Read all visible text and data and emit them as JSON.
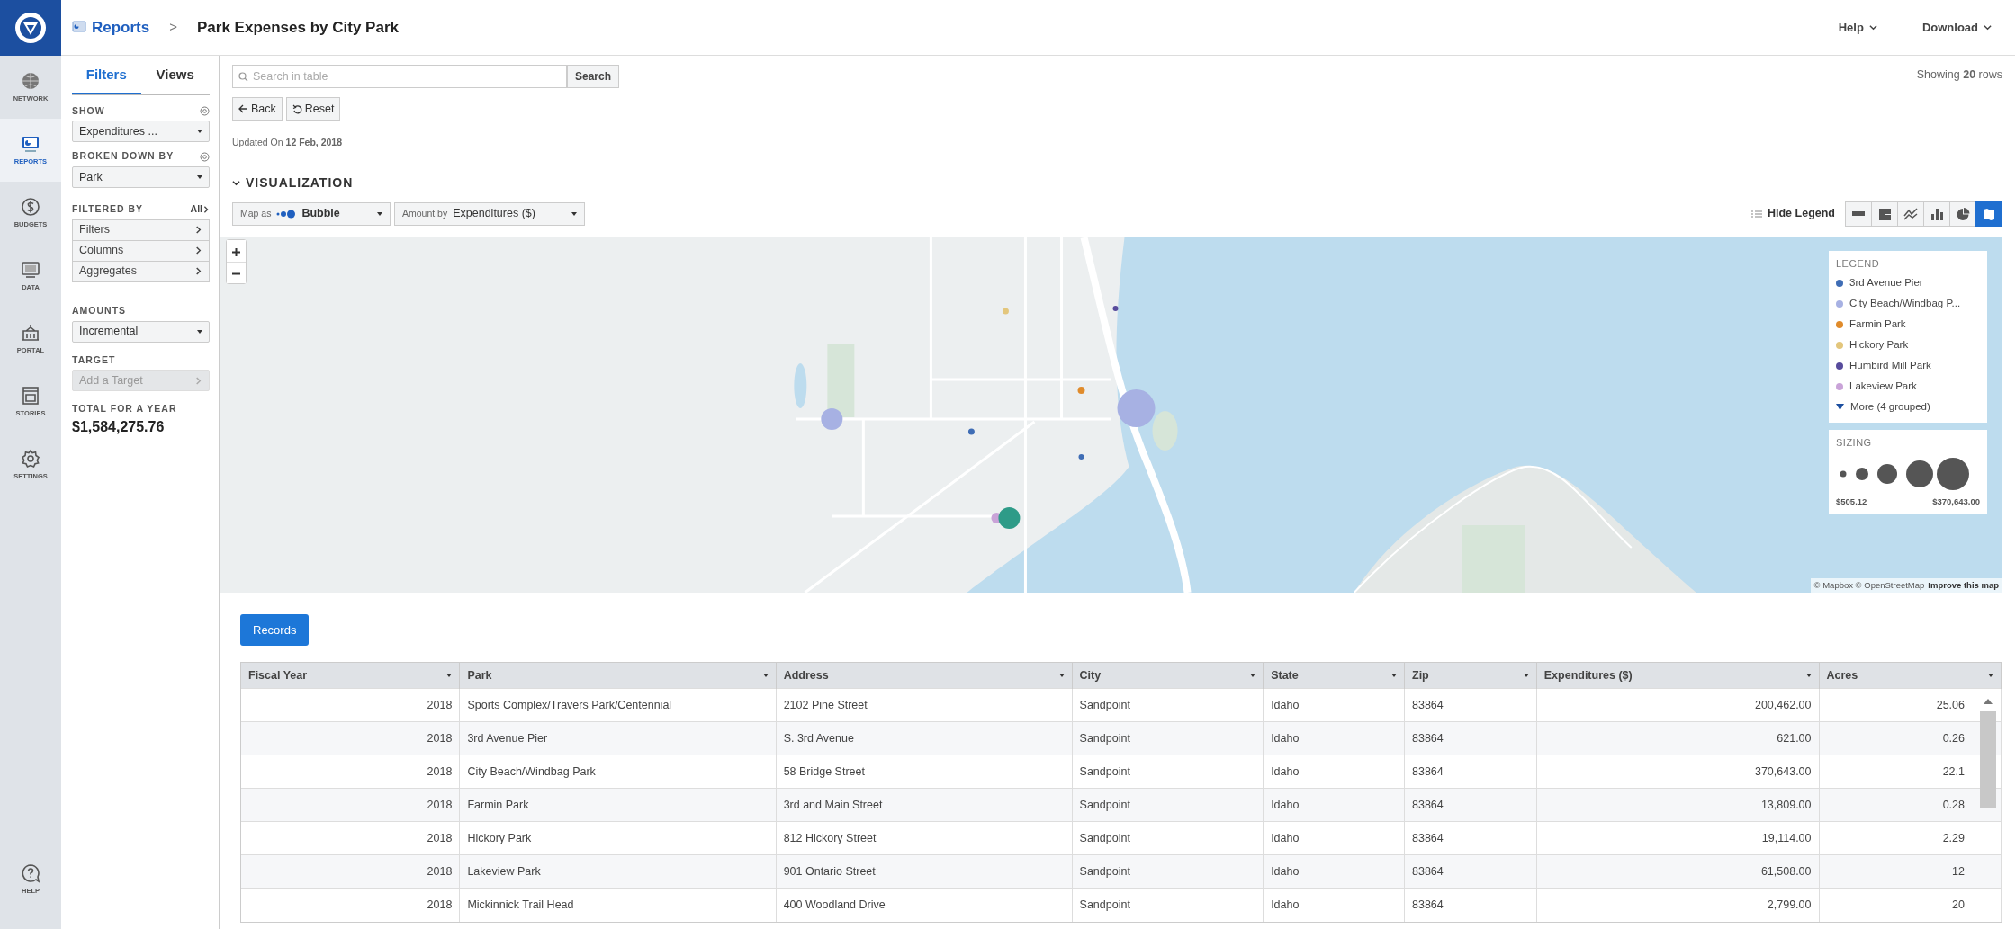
{
  "header": {
    "breadcrumb": "Reports",
    "separator": ">",
    "title": "Park Expenses by City Park",
    "menus": [
      {
        "label": "Help"
      },
      {
        "label": "Download"
      }
    ]
  },
  "nav": {
    "items": [
      {
        "label": "NETWORK",
        "kind": "globe",
        "selected": false
      },
      {
        "label": "REPORTS",
        "kind": "reports",
        "selected": true
      },
      {
        "label": "BUDGETS",
        "kind": "dollar",
        "selected": false
      },
      {
        "label": "DATA",
        "kind": "monitor",
        "selected": false
      },
      {
        "label": "PORTAL",
        "kind": "building",
        "selected": false
      },
      {
        "label": "STORIES",
        "kind": "stories",
        "selected": false
      },
      {
        "label": "SETTINGS",
        "kind": "gear",
        "selected": false
      }
    ],
    "help": {
      "label": "HELP"
    }
  },
  "filters_panel": {
    "tabs": [
      {
        "label": "Filters",
        "selected": true
      },
      {
        "label": "Views",
        "selected": false
      }
    ],
    "show": {
      "label": "SHOW",
      "value": "Expenditures ..."
    },
    "broken_down_by": {
      "label": "BROKEN DOWN BY",
      "value": "Park"
    },
    "filtered_by": {
      "label": "FILTERED BY",
      "link": "All",
      "items": [
        {
          "label": "Filters"
        },
        {
          "label": "Columns"
        },
        {
          "label": "Aggregates"
        }
      ]
    },
    "amounts": {
      "label": "AMOUNTS",
      "value": "Incremental"
    },
    "target": {
      "label": "TARGET",
      "value": "Add a Target",
      "disabled": true
    },
    "total": {
      "label": "TOTAL FOR A YEAR",
      "value": "$1,584,275.76"
    }
  },
  "toolbar": {
    "search": {
      "placeholder": "Search in table",
      "button": "Search"
    },
    "showing": "Showing **20** rows",
    "back": "Back",
    "reset": "Reset",
    "updated": "Updated On **12 Feb, 2018**"
  },
  "visualization": {
    "title": "VISUALIZATION",
    "map_as": {
      "prefix": "Map as",
      "value": "Bubble"
    },
    "amount_by": {
      "prefix": "Amount by",
      "value": "Expenditures ($)"
    },
    "hide_legend": "Hide Legend",
    "chart_types": [
      {
        "kind": "stacked",
        "selected": false
      },
      {
        "kind": "treemap",
        "selected": false
      },
      {
        "kind": "line",
        "selected": false
      },
      {
        "kind": "bar",
        "selected": false
      },
      {
        "kind": "pie",
        "selected": false
      },
      {
        "kind": "map",
        "selected": true
      }
    ],
    "map": {
      "kind": "picture",
      "attribution": "© Mapbox © OpenStreetMap",
      "improve": "Improve this map",
      "legend": {
        "title": "LEGEND",
        "items": [
          {
            "label": "3rd Avenue Pier",
            "color": "#3f6db5"
          },
          {
            "label": "City Beach/Windbag P...",
            "color": "#a7b1e3"
          },
          {
            "label": "Farmin Park",
            "color": "#e08b2b"
          },
          {
            "label": "Hickory Park",
            "color": "#e3c67c"
          },
          {
            "label": "Humbird Mill Park",
            "color": "#574b9c"
          },
          {
            "label": "Lakeview Park",
            "color": "#c9a3d8"
          }
        ],
        "more": "More (4 grouped)"
      },
      "sizing": {
        "title": "SIZING",
        "min": "$505.12",
        "max": "$370,643.00"
      }
    }
  },
  "records": {
    "button": "Records",
    "columns": [
      {
        "label": "Fiscal Year",
        "numeric": true
      },
      {
        "label": "Park",
        "numeric": false
      },
      {
        "label": "Address",
        "numeric": false
      },
      {
        "label": "City",
        "numeric": false
      },
      {
        "label": "State",
        "numeric": false
      },
      {
        "label": "Zip",
        "numeric": false
      },
      {
        "label": "Expenditures ($)",
        "numeric": true
      },
      {
        "label": "Acres",
        "numeric": true
      }
    ],
    "rows": [
      [
        "2018",
        "Sports Complex/Travers Park/Centennial",
        "2102 Pine Street",
        "Sandpoint",
        "Idaho",
        "83864",
        "200,462.00",
        "25.06"
      ],
      [
        "2018",
        "3rd Avenue Pier",
        "S. 3rd Avenue",
        "Sandpoint",
        "Idaho",
        "83864",
        "621.00",
        "0.26"
      ],
      [
        "2018",
        "City Beach/Windbag Park",
        "58 Bridge Street",
        "Sandpoint",
        "Idaho",
        "83864",
        "370,643.00",
        "22.1"
      ],
      [
        "2018",
        "Farmin Park",
        "3rd and Main Street",
        "Sandpoint",
        "Idaho",
        "83864",
        "13,809.00",
        "0.28"
      ],
      [
        "2018",
        "Hickory Park",
        "812 Hickory Street",
        "Sandpoint",
        "Idaho",
        "83864",
        "19,114.00",
        "2.29"
      ],
      [
        "2018",
        "Lakeview Park",
        "901 Ontario Street",
        "Sandpoint",
        "Idaho",
        "83864",
        "61,508.00",
        "12"
      ],
      [
        "2018",
        "Mickinnick Trail Head",
        "400 Woodland Drive",
        "Sandpoint",
        "Idaho",
        "83864",
        "2,799.00",
        "20"
      ]
    ]
  }
}
